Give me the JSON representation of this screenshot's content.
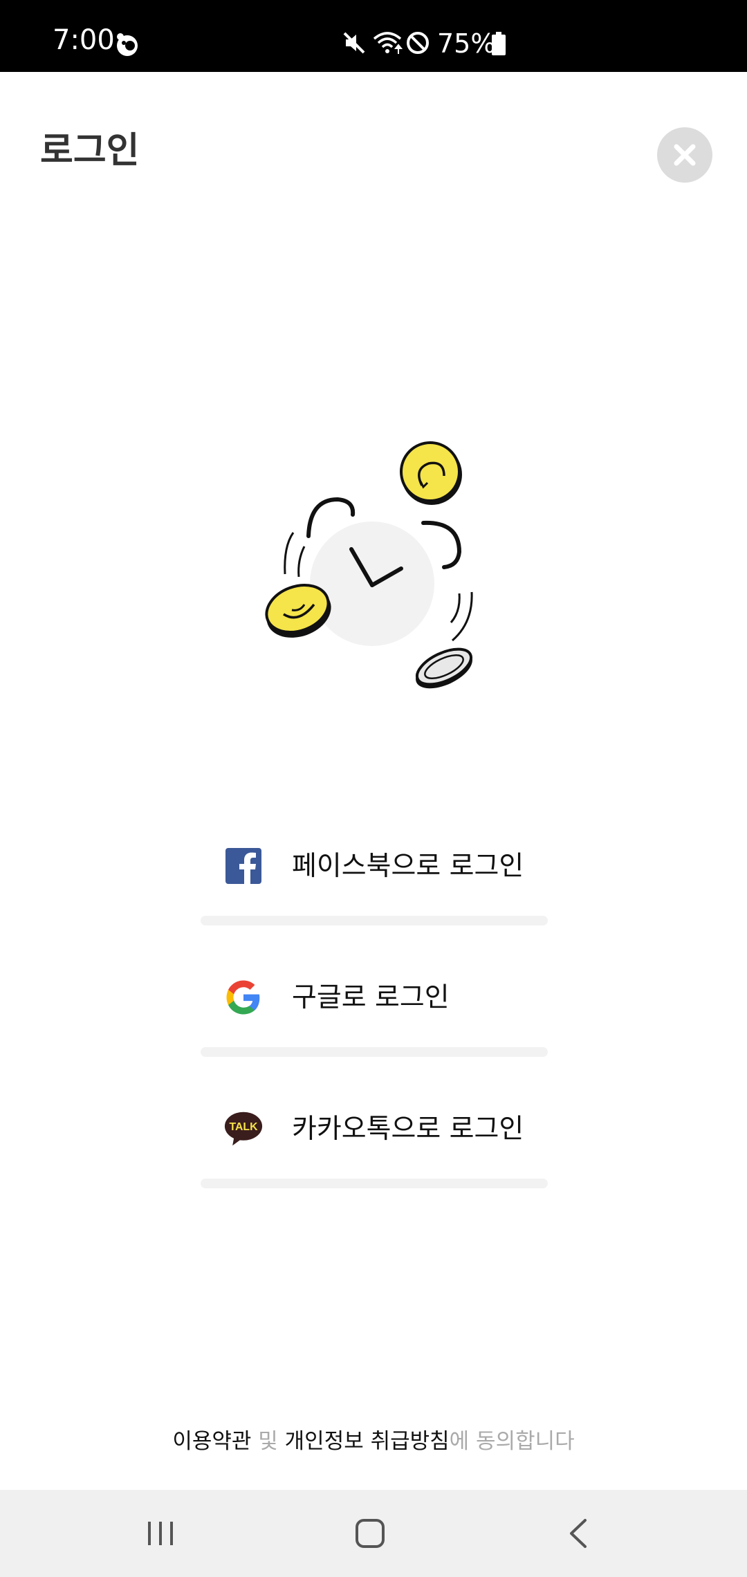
{
  "status_bar": {
    "time": "7:00",
    "battery": "75%",
    "icons": [
      "app-notification-icon",
      "mute-icon",
      "wifi-icon",
      "do-not-disturb-icon",
      "battery-icon"
    ]
  },
  "header": {
    "title": "로그인",
    "close_icon": "close-icon"
  },
  "login_options": [
    {
      "label": "페이스북으로 로그인",
      "icon": "facebook-icon",
      "color": "#3b5998"
    },
    {
      "label": "구글로 로그인",
      "icon": "google-icon",
      "color": "#4285f4"
    },
    {
      "label": "카카오톡으로 로그인",
      "icon": "kakaotalk-icon",
      "color": "#3a1d1d"
    }
  ],
  "terms": {
    "terms_of_use": "이용약관",
    "and": " 및 ",
    "privacy_policy": "개인정보 취급방침",
    "agree": "에 동의합니다"
  },
  "nav_bar": {
    "icons": [
      "recent-apps-icon",
      "home-icon",
      "back-icon"
    ]
  },
  "colors": {
    "coin_yellow": "#f5e44a",
    "close_bg": "#dcdcdc",
    "divider": "#f2f2f2"
  }
}
